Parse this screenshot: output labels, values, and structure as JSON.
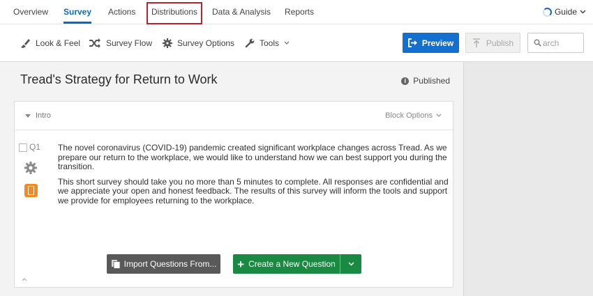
{
  "nav": {
    "tabs": [
      {
        "label": "Overview"
      },
      {
        "label": "Survey"
      },
      {
        "label": "Actions"
      },
      {
        "label": "Distributions"
      },
      {
        "label": "Data & Analysis"
      },
      {
        "label": "Reports"
      }
    ],
    "active_tab": "Survey",
    "highlighted_tab": "Distributions",
    "guide_label": "Guide"
  },
  "toolbar": {
    "look_feel": "Look & Feel",
    "survey_flow": "Survey Flow",
    "survey_options": "Survey Options",
    "tools": "Tools",
    "preview": "Preview",
    "publish": "Publish",
    "search_placeholder": "Search",
    "search_visible_text": "arch"
  },
  "survey": {
    "title": "Tread's Strategy for Return to Work",
    "status": "Published"
  },
  "block": {
    "name": "Intro",
    "options_label": "Block Options",
    "question": {
      "number": "Q1",
      "paragraphs": [
        "The novel coronavirus (COVID-19) pandemic created significant workplace changes across Tread. As we prepare our return to the workplace, we would like to understand how we can best support you during the transition.",
        "This short survey should take you no more than 5 minutes to complete. All responses are confidential and we appreciate your open and honest feedback. The results of this survey will inform the tools and support we provide for employees returning to the workplace."
      ]
    },
    "import_button": "Import Questions From...",
    "create_button": "Create a New Question"
  },
  "colors": {
    "accent": "#0a6bc4",
    "preview_button": "#1470cf",
    "create_button": "#1a8a42",
    "import_button": "#595959",
    "highlight_box": "#b8232f",
    "mobile_icon": "#f28a22"
  }
}
